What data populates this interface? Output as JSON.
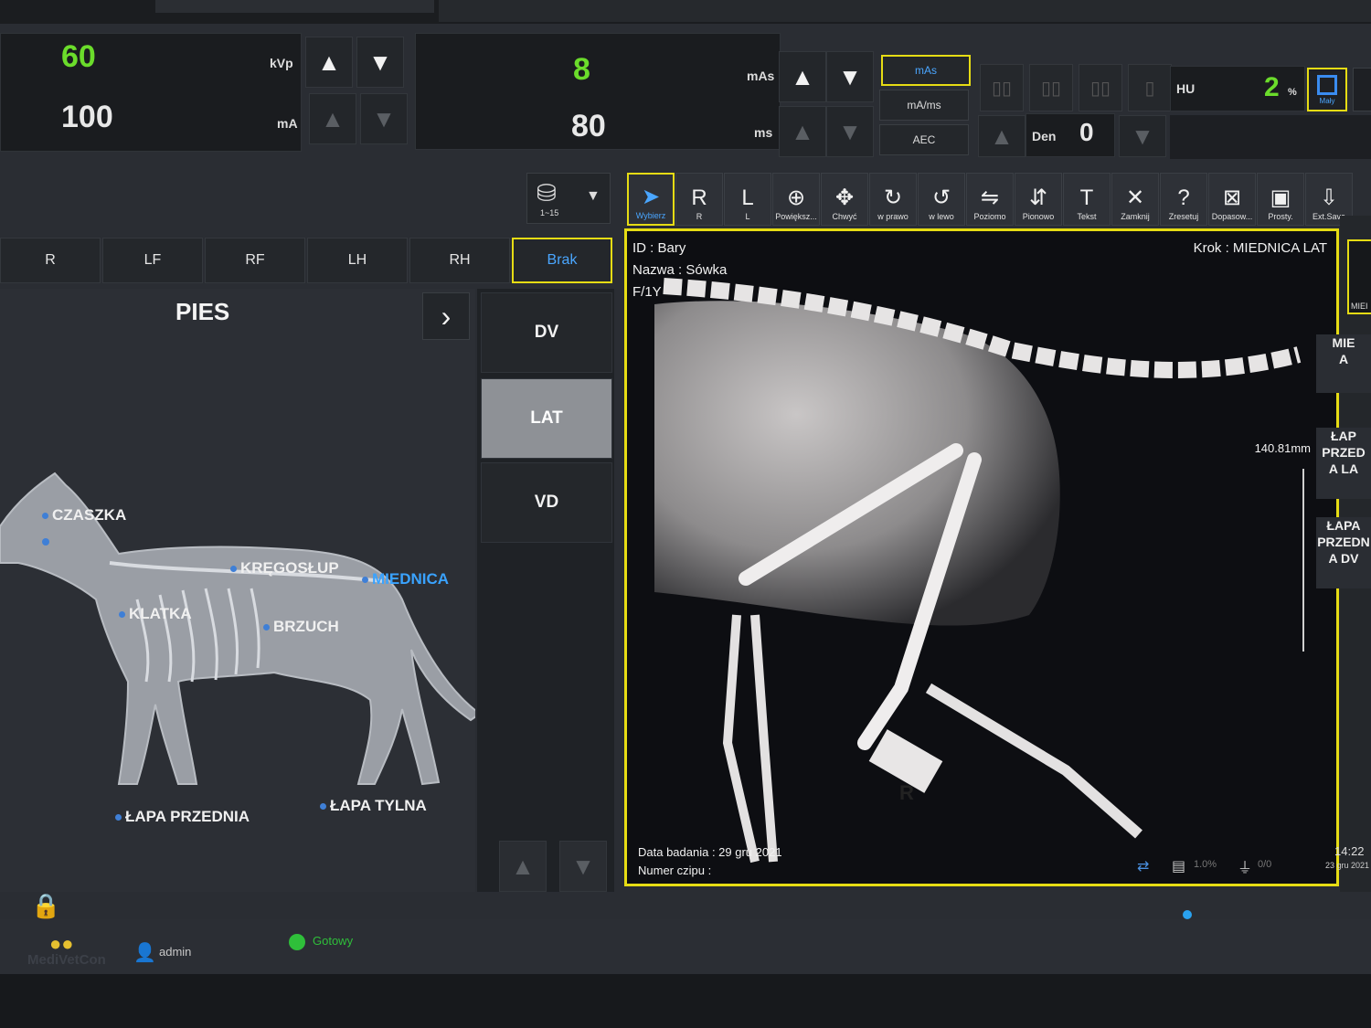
{
  "exposure": {
    "kvp": {
      "value": "60",
      "unit": "kVp"
    },
    "ma": {
      "value": "100",
      "unit": "mA"
    },
    "mas": {
      "value": "8",
      "unit": "mAs"
    },
    "ms": {
      "value": "80",
      "unit": "ms"
    },
    "mode_buttons": [
      "mAs",
      "mA/ms",
      "AEC"
    ],
    "hu": {
      "label": "HU",
      "value": "2",
      "unit": "%"
    },
    "den": {
      "label": "Den",
      "value": "0"
    },
    "focus_label": "Mały",
    "arrows": {
      "up": "▲",
      "down": "▼"
    }
  },
  "size_selector": {
    "label": "1~15"
  },
  "toolbar": [
    {
      "icon": "➤",
      "label": "Wybierz",
      "active": true
    },
    {
      "icon": "R",
      "label": "R"
    },
    {
      "icon": "L",
      "label": "L"
    },
    {
      "icon": "⊕",
      "label": "Powiększ..."
    },
    {
      "icon": "✥",
      "label": "Chwyć"
    },
    {
      "icon": "↻",
      "label": "w prawo"
    },
    {
      "icon": "↺",
      "label": "w lewo"
    },
    {
      "icon": "⇋",
      "label": "Poziomo"
    },
    {
      "icon": "⇵",
      "label": "Pionowo"
    },
    {
      "icon": "T",
      "label": "Tekst"
    },
    {
      "icon": "✕",
      "label": "Zamknij"
    },
    {
      "icon": "?",
      "label": "Zresetuj"
    },
    {
      "icon": "⊠",
      "label": "Dopasow..."
    },
    {
      "icon": "▣",
      "label": "Prosty."
    },
    {
      "icon": "⇩",
      "label": "Ext.Save"
    }
  ],
  "position_tabs": [
    "R",
    "LF",
    "RF",
    "LH",
    "RH",
    "Brak"
  ],
  "anatomy": {
    "species": "PIES",
    "next": "›",
    "regions": {
      "skull": "CZASZKA",
      "spine": "KRĘGOSŁUP",
      "pelvis": "MIEDNICA",
      "chest": "KLATKA",
      "abdomen": "BRZUCH",
      "front_paw": "ŁAPA PRZEDNIA",
      "hind_paw": "ŁAPA TYLNA"
    }
  },
  "views": [
    "DV",
    "LAT",
    "VD"
  ],
  "viewer": {
    "id_line": "ID : Bary",
    "name_line": "Nazwa : Sówka",
    "sex_age": "F/1Y",
    "step": "Krok : MIEDNICA LAT",
    "measure": "140.81mm",
    "exam_date": "Data badania : 29 gru 2021",
    "chip": "Numer czipu :",
    "marker": "R"
  },
  "side_list": [
    "MIE\nA",
    "ŁAP\nPRZED\nA LA",
    "ŁAPA\nPRZEDN\nA DV"
  ],
  "thumb_label": "MIEI",
  "status": {
    "user": "admin",
    "state": "Gotowy",
    "brand": "MediVetCon",
    "storage": "1.0%",
    "usb": "0/0",
    "time": "14:22",
    "date": "23 gru 2021"
  },
  "colors": {
    "accent_yellow": "#e6dc14",
    "value_green": "#6bdc2b",
    "select_blue": "#3aa3ff"
  }
}
